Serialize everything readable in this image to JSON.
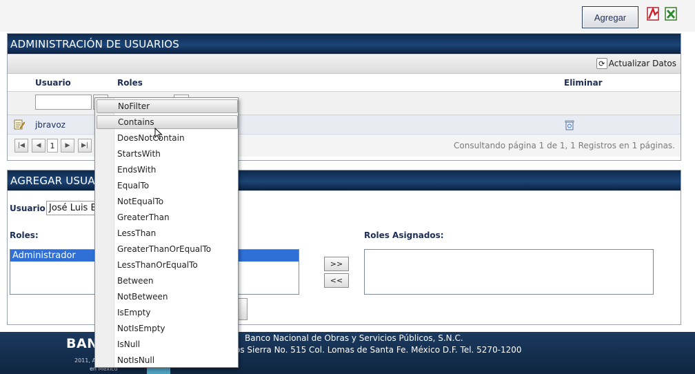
{
  "header": {
    "add_button": "Agregar",
    "pdf_icon": "pdf-export-icon",
    "excel_icon": "excel-export-icon"
  },
  "users_panel": {
    "title": "ADMINISTRACIÓN DE USUARIOS",
    "refresh_label": "Actualizar Datos",
    "columns": [
      "Usuario",
      "Roles",
      "Eliminar"
    ],
    "filter_value": "",
    "rows": [
      {
        "user": "jbravoz",
        "roles": ""
      }
    ],
    "pager": {
      "current_page": "1",
      "info": "Consultando página 1 de 1, 1 Registros en 1 páginas."
    }
  },
  "filter_menu": {
    "items": [
      "NoFilter",
      "Contains",
      "DoesNotContain",
      "StartsWith",
      "EndsWith",
      "EqualTo",
      "NotEqualTo",
      "GreaterThan",
      "LessThan",
      "GreaterThanOrEqualTo",
      "LessThanOrEqualTo",
      "Between",
      "NotBetween",
      "IsEmpty",
      "NotIsEmpty",
      "IsNull",
      "NotIsNull"
    ],
    "hovered": "Contains"
  },
  "add_panel": {
    "title": "AGREGAR USUAR",
    "user_label": "Usuario:",
    "user_value": "José Luis B",
    "roles_label": "Roles:",
    "roles_available": [
      "Administrador"
    ],
    "assigned_label": "Roles Asignados:",
    "move_right": ">>",
    "move_left": "<<"
  },
  "footer": {
    "logo": "BAN",
    "small_text": "2011, Ac",
    "small_text_2": "en México",
    "line1": "Banco Nacional de Obras y Servicios Públicos, S.N.C.",
    "line2": "os Sierra No. 515 Col. Lomas de Santa Fe. México D.F. Tel. 5270-1200"
  }
}
